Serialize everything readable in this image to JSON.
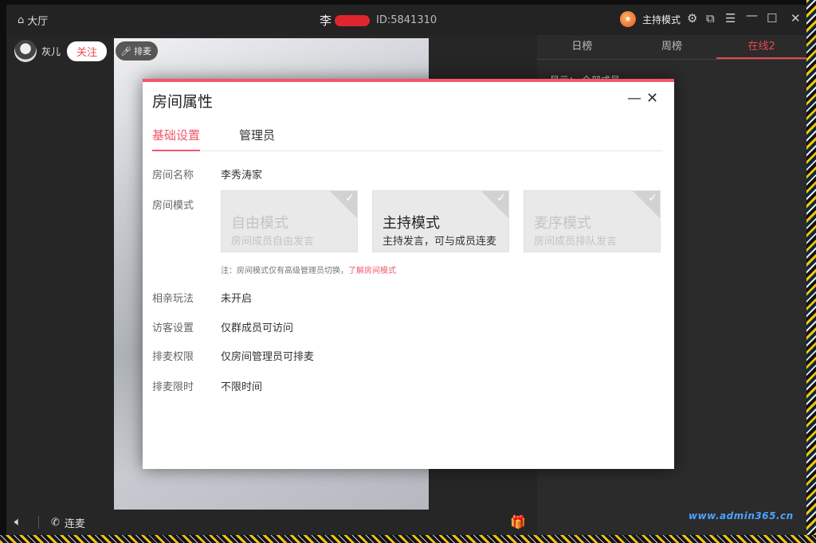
{
  "titlebar": {
    "lobby_label": "大厅",
    "title_prefix": "李",
    "room_id": "ID:5841310",
    "host_mode_label": "主持模式"
  },
  "left": {
    "user_name": "灰儿",
    "follow_label": "关注",
    "queue_label": "排麦",
    "mic_link_label": "连麦"
  },
  "right_panel": {
    "tabs": [
      "日榜",
      "周榜",
      "在线2"
    ],
    "show_prefix": "显示：",
    "show_value": "全部成员"
  },
  "watermark": "www.admin365.cn",
  "dialog": {
    "title": "房间属性",
    "tabs": [
      "基础设置",
      "管理员"
    ],
    "room_name_label": "房间名称",
    "room_name_value": "李秀涛家",
    "room_mode_label": "房间模式",
    "modes": [
      {
        "title": "自由模式",
        "desc": "房间成员自由发言",
        "active": false
      },
      {
        "title": "主持模式",
        "desc": "主持发言，可与成员连麦",
        "active": true
      },
      {
        "title": "麦序模式",
        "desc": "房间成员排队发言",
        "active": false
      }
    ],
    "note_text": "注：房间模式仅有高级管理员切换，",
    "note_link": "了解房间模式",
    "dating_label": "相亲玩法",
    "dating_value": "未开启",
    "visitor_label": "访客设置",
    "visitor_value": "仅群成员可访问",
    "queue_perm_label": "排麦权限",
    "queue_perm_value": "仅房间管理员可排麦",
    "queue_limit_label": "排麦限时",
    "queue_limit_value": "不限时间"
  },
  "colors": {
    "accent": "#f0586a",
    "follow_text": "#e8474d"
  }
}
